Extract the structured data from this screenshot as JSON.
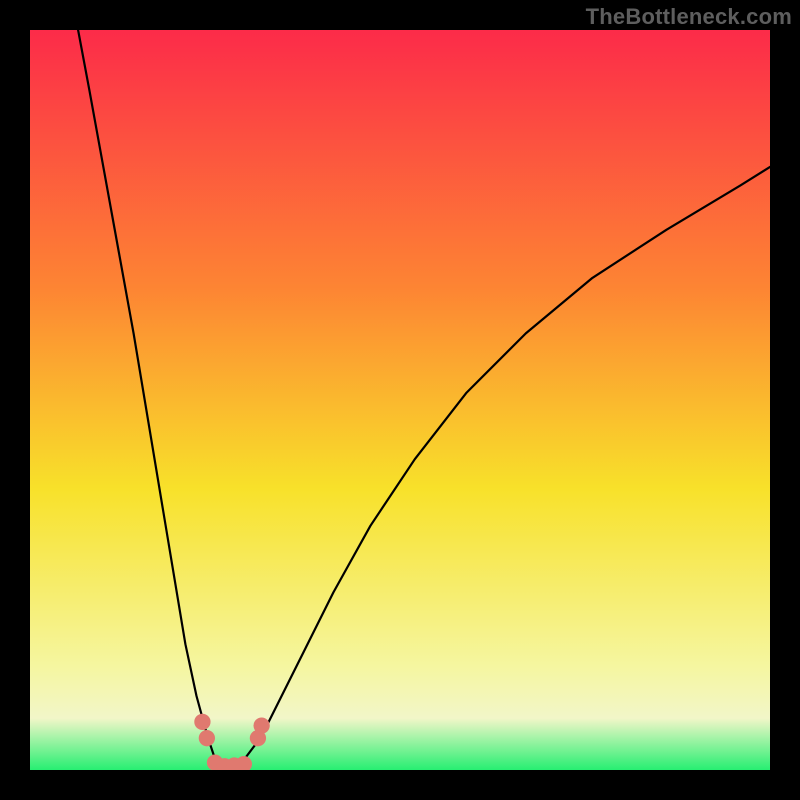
{
  "watermark": "TheBottleneck.com",
  "chart_data": {
    "type": "line",
    "title": "",
    "xlabel": "",
    "ylabel": "",
    "xlim": [
      0,
      100
    ],
    "ylim": [
      0,
      100
    ],
    "background_gradient": {
      "top": "#fc2b49",
      "upper_mid": "#fd8533",
      "mid": "#f8e12a",
      "lower_mid": "#f5f6a0",
      "bottom_band": "#f2f6c8",
      "bottom": "#27ef72"
    },
    "series": [
      {
        "name": "left-branch",
        "x": [
          6.5,
          8,
          10,
          12,
          14,
          16,
          18,
          19.5,
          21,
          22.5,
          24,
          25,
          25.8
        ],
        "y": [
          100,
          92,
          81,
          70,
          59,
          47,
          35,
          26,
          17,
          10,
          4.5,
          1.5,
          0.6
        ]
      },
      {
        "name": "right-branch",
        "x": [
          28,
          29,
          30.5,
          32,
          34,
          37,
          41,
          46,
          52,
          59,
          67,
          76,
          86,
          96,
          100
        ],
        "y": [
          0.6,
          1.5,
          3.5,
          6,
          10,
          16,
          24,
          33,
          42,
          51,
          59,
          66.5,
          73,
          79,
          81.5
        ]
      }
    ],
    "markers": {
      "name": "highlight-dots",
      "color": "#e0796f",
      "radius_pct": 1.1,
      "points": [
        {
          "x": 23.3,
          "y": 6.5
        },
        {
          "x": 23.9,
          "y": 4.3
        },
        {
          "x": 25.0,
          "y": 1.0
        },
        {
          "x": 26.3,
          "y": 0.5
        },
        {
          "x": 27.6,
          "y": 0.6
        },
        {
          "x": 28.9,
          "y": 0.8
        },
        {
          "x": 30.8,
          "y": 4.3
        },
        {
          "x": 31.3,
          "y": 6.0
        }
      ]
    }
  }
}
